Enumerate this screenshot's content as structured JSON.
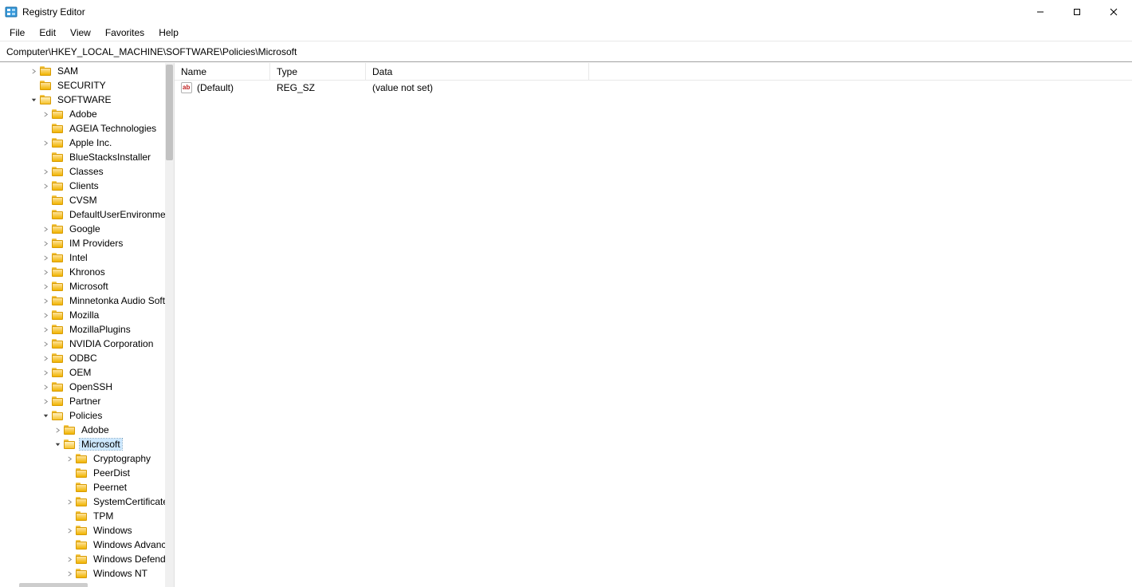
{
  "window": {
    "title": "Registry Editor"
  },
  "menu": [
    "File",
    "Edit",
    "View",
    "Favorites",
    "Help"
  ],
  "address": "Computer\\HKEY_LOCAL_MACHINE\\SOFTWARE\\Policies\\Microsoft",
  "tree": [
    {
      "indent": 2,
      "expander": "closed",
      "label": "SAM"
    },
    {
      "indent": 2,
      "expander": "none",
      "label": "SECURITY"
    },
    {
      "indent": 2,
      "expander": "open",
      "label": "SOFTWARE",
      "open": true
    },
    {
      "indent": 3,
      "expander": "closed",
      "label": "Adobe"
    },
    {
      "indent": 3,
      "expander": "none",
      "label": "AGEIA Technologies"
    },
    {
      "indent": 3,
      "expander": "closed",
      "label": "Apple Inc."
    },
    {
      "indent": 3,
      "expander": "none",
      "label": "BlueStacksInstaller"
    },
    {
      "indent": 3,
      "expander": "closed",
      "label": "Classes"
    },
    {
      "indent": 3,
      "expander": "closed",
      "label": "Clients"
    },
    {
      "indent": 3,
      "expander": "none",
      "label": "CVSM"
    },
    {
      "indent": 3,
      "expander": "none",
      "label": "DefaultUserEnvironment"
    },
    {
      "indent": 3,
      "expander": "closed",
      "label": "Google"
    },
    {
      "indent": 3,
      "expander": "closed",
      "label": "IM Providers"
    },
    {
      "indent": 3,
      "expander": "closed",
      "label": "Intel"
    },
    {
      "indent": 3,
      "expander": "closed",
      "label": "Khronos"
    },
    {
      "indent": 3,
      "expander": "closed",
      "label": "Microsoft"
    },
    {
      "indent": 3,
      "expander": "closed",
      "label": "Minnetonka Audio Software"
    },
    {
      "indent": 3,
      "expander": "closed",
      "label": "Mozilla"
    },
    {
      "indent": 3,
      "expander": "closed",
      "label": "MozillaPlugins"
    },
    {
      "indent": 3,
      "expander": "closed",
      "label": "NVIDIA Corporation"
    },
    {
      "indent": 3,
      "expander": "closed",
      "label": "ODBC"
    },
    {
      "indent": 3,
      "expander": "closed",
      "label": "OEM"
    },
    {
      "indent": 3,
      "expander": "closed",
      "label": "OpenSSH"
    },
    {
      "indent": 3,
      "expander": "closed",
      "label": "Partner"
    },
    {
      "indent": 3,
      "expander": "open",
      "label": "Policies",
      "open": true
    },
    {
      "indent": 4,
      "expander": "closed",
      "label": "Adobe"
    },
    {
      "indent": 4,
      "expander": "open",
      "label": "Microsoft",
      "open": true,
      "selected": true
    },
    {
      "indent": 5,
      "expander": "closed",
      "label": "Cryptography"
    },
    {
      "indent": 5,
      "expander": "none",
      "label": "PeerDist"
    },
    {
      "indent": 5,
      "expander": "none",
      "label": "Peernet"
    },
    {
      "indent": 5,
      "expander": "closed",
      "label": "SystemCertificates"
    },
    {
      "indent": 5,
      "expander": "none",
      "label": "TPM"
    },
    {
      "indent": 5,
      "expander": "closed",
      "label": "Windows"
    },
    {
      "indent": 5,
      "expander": "none",
      "label": "Windows Advanced Threat Protection"
    },
    {
      "indent": 5,
      "expander": "closed",
      "label": "Windows Defender"
    },
    {
      "indent": 5,
      "expander": "closed",
      "label": "Windows NT"
    }
  ],
  "list": {
    "columns": {
      "name": "Name",
      "type": "Type",
      "data": "Data"
    },
    "rows": [
      {
        "icon": "string",
        "name": "(Default)",
        "type": "REG_SZ",
        "data": "(value not set)"
      }
    ]
  }
}
